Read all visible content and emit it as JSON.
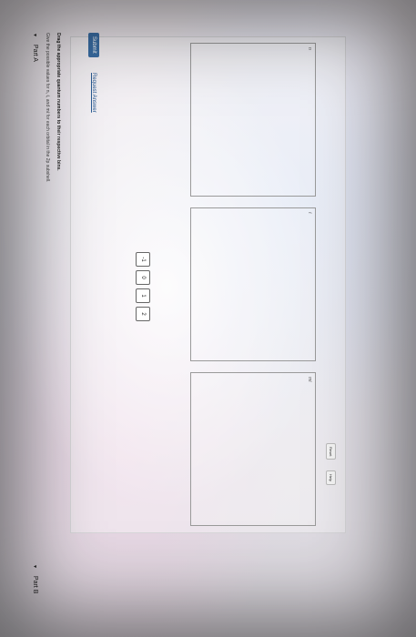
{
  "part_a": {
    "caret": "▼",
    "title": "Part A",
    "instruction": "Give the possible values for n, ℓ, and mℓ for each orbital in the 2p subshell.",
    "drag_instruction": "Drag the appropriate quantum numbers to their respective bins."
  },
  "toolbar": {
    "reset_label": "Reset",
    "help_label": "Help"
  },
  "tiles": [
    "-1",
    "0",
    "1",
    "2"
  ],
  "bins": [
    {
      "label": "n"
    },
    {
      "label": "ℓ"
    },
    {
      "label": "mℓ"
    }
  ],
  "actions": {
    "submit_label": "Submit",
    "request_answer_label": "Request Answer"
  },
  "part_b": {
    "caret": "▼",
    "title": "Part B"
  }
}
